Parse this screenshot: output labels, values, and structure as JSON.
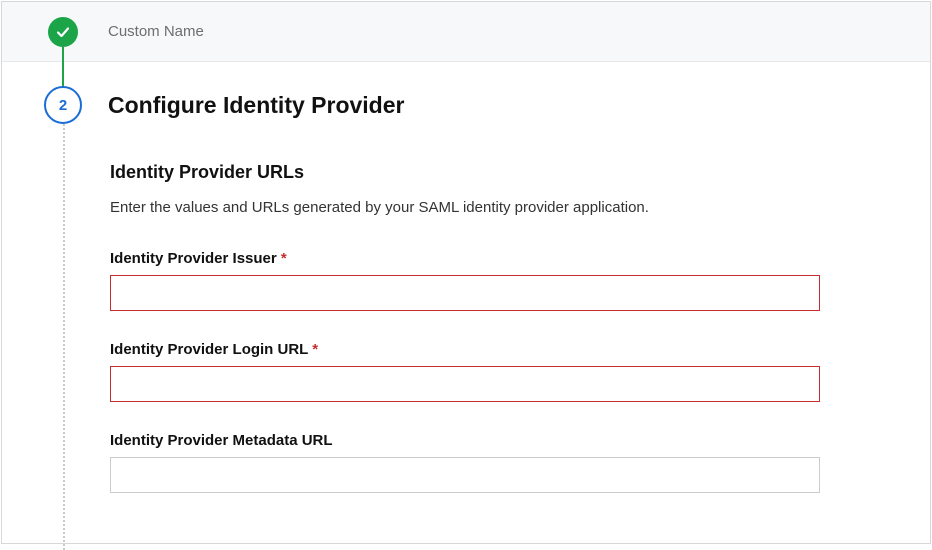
{
  "step1": {
    "label": "Custom Name"
  },
  "step2": {
    "number": "2",
    "title": "Configure Identity Provider"
  },
  "section": {
    "title": "Identity Provider URLs",
    "description": "Enter the values and URLs generated by your SAML identity provider application."
  },
  "fields": {
    "issuer": {
      "label": "Identity Provider Issuer",
      "required": "*",
      "value": ""
    },
    "loginUrl": {
      "label": "Identity Provider Login URL",
      "required": "*",
      "value": ""
    },
    "metadataUrl": {
      "label": "Identity Provider Metadata URL",
      "value": ""
    }
  }
}
